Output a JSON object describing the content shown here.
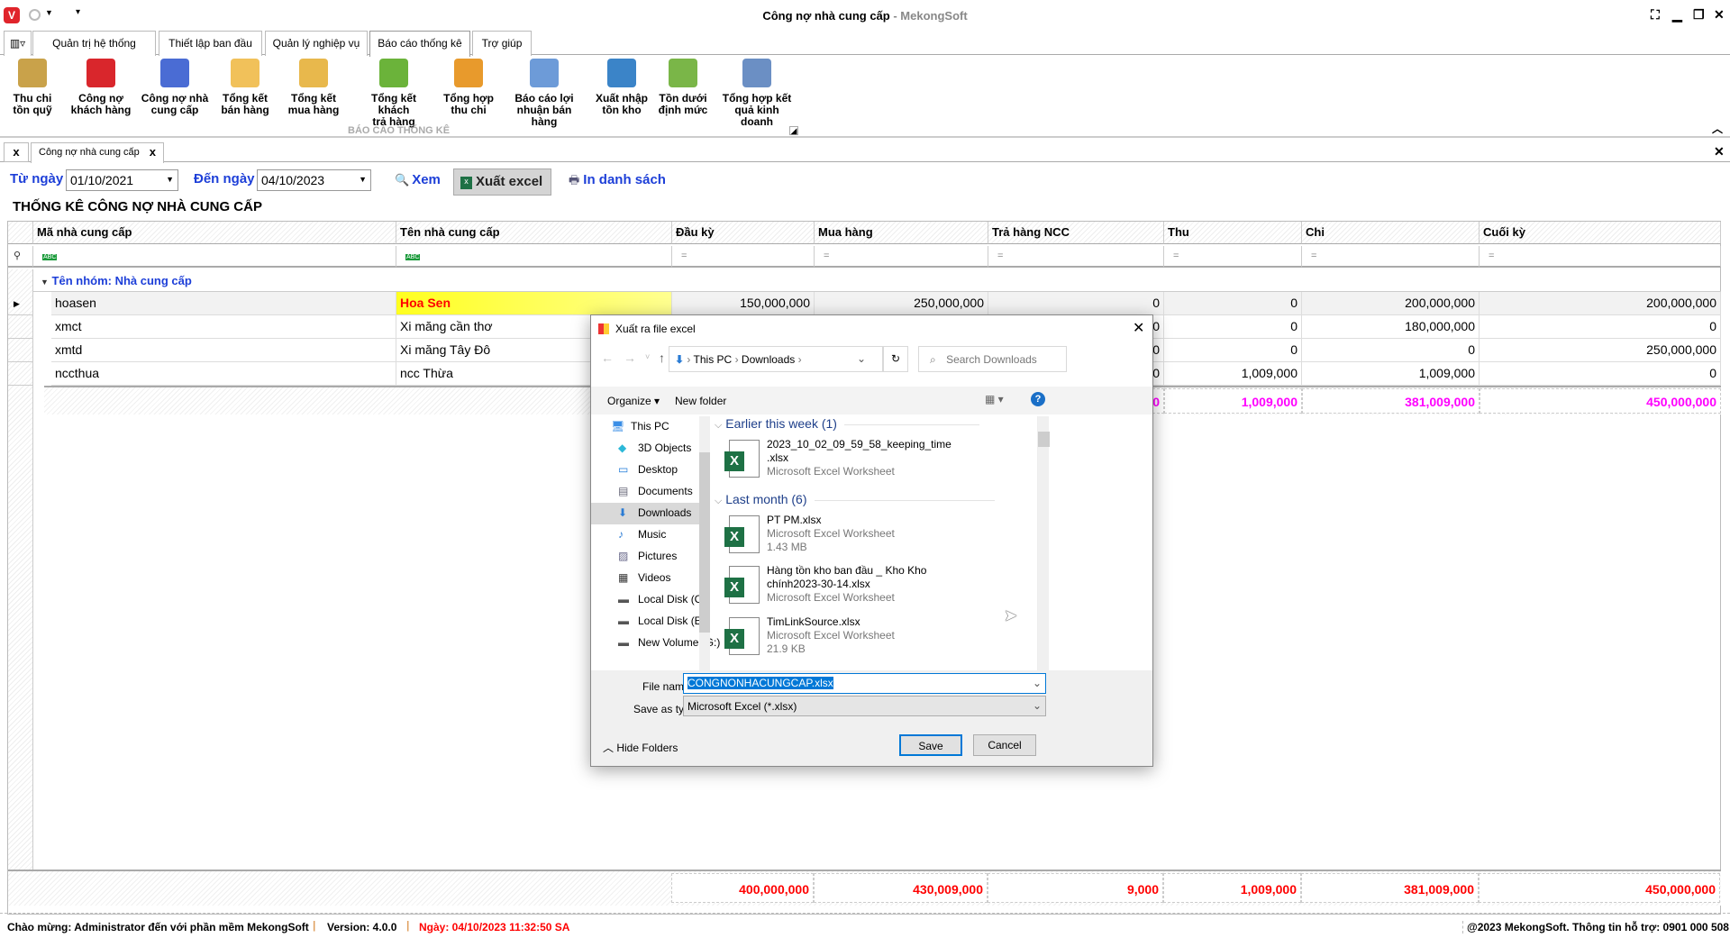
{
  "window": {
    "title": "Công nợ nhà cung cấp",
    "app": "MekongSoft",
    "app_sep": " - "
  },
  "ribbon": {
    "tabs": [
      "Quản trị hệ thống",
      "Thiết lập ban đầu",
      "Quản lý nghiệp vụ",
      "Báo cáo thống kê",
      "Trợ giúp"
    ],
    "active_tab": 3,
    "buttons": [
      [
        "Thu chi",
        "tồn quỹ"
      ],
      [
        "Công nợ",
        "khách hàng"
      ],
      [
        "Công nợ nhà",
        "cung cấp"
      ],
      [
        "Tổng kết",
        "bán hàng"
      ],
      [
        "Tổng kết",
        "mua hàng"
      ],
      [
        "Tổng kết khách",
        "trả hàng"
      ],
      [
        "Tổng hợp",
        "thu chi"
      ],
      [
        "Báo cáo lợi",
        "nhuận bán hàng"
      ],
      [
        "Xuất nhập",
        "tồn kho"
      ],
      [
        "Tồn dưới",
        "định mức"
      ],
      [
        "Tổng hợp kết",
        "quả kinh doanh"
      ]
    ],
    "group_label": "BÁO CÁO THỐNG KÊ"
  },
  "doc_tab": {
    "label": "Công nợ nhà cung cấp",
    "close": "x"
  },
  "toolbar": {
    "from_label": "Từ ngày",
    "from_value": "01/10/2021",
    "to_label": "Đến ngày",
    "to_value": "04/10/2023",
    "view": "Xem",
    "export": "Xuất excel",
    "print": "In danh sách"
  },
  "report_title": "THỐNG KÊ CÔNG NỢ NHÀ CUNG CẤP",
  "grid": {
    "columns": [
      "Mã nhà cung cấp",
      "Tên nhà cung cấp",
      "Đầu kỳ",
      "Mua hàng",
      "Trả hàng NCC",
      "Thu",
      "Chi",
      "Cuối kỳ"
    ],
    "filter_text": "ABC",
    "filter_eq": "=",
    "group_label": "Tên nhóm: Nhà cung cấp",
    "rows": [
      [
        "hoasen",
        "Hoa Sen",
        "150,000,000",
        "250,000,000",
        "0",
        "0",
        "200,000,000",
        "200,000,000"
      ],
      [
        "xmct",
        "Xi măng cần thơ",
        "",
        "",
        "0",
        "0",
        "180,000,000",
        "0"
      ],
      [
        "xmtd",
        "Xi măng Tây Đô",
        "",
        "",
        "0",
        "0",
        "0",
        "250,000,000"
      ],
      [
        "nccthua",
        "ncc Thừa",
        "",
        "",
        "0",
        "1,009,000",
        "1,009,000",
        "0"
      ]
    ],
    "group_totals": [
      "0",
      "1,009,000",
      "381,009,000",
      "450,000,000"
    ],
    "totals": [
      "400,000,000",
      "430,009,000",
      "9,000",
      "1,009,000",
      "381,009,000",
      "450,000,000"
    ]
  },
  "status": {
    "welcome": "Chào mừng: Administrator đến với phần mềm MekongSoft",
    "version": "Version: 4.0.0",
    "date": "Ngày: 04/10/2023 11:32:50 SA",
    "copyright": "@2023 MekongSoft. Thông tin hỗ trợ: 0901 000 508"
  },
  "dialog": {
    "title": "Xuất ra file excel",
    "path": [
      "This PC",
      "Downloads"
    ],
    "search_placeholder": "Search Downloads",
    "organize": "Organize",
    "new_folder": "New folder",
    "nav": [
      "This PC",
      "3D Objects",
      "Desktop",
      "Documents",
      "Downloads",
      "Music",
      "Pictures",
      "Videos",
      "Local Disk (C:)",
      "Local Disk (E:)",
      "New Volume (G:)"
    ],
    "groups": [
      {
        "label": "Earlier this week (1)",
        "files": [
          {
            "name": "2023_10_02_09_59_58_keeping_time .xlsx",
            "type": "Microsoft Excel Worksheet",
            "size": ""
          }
        ]
      },
      {
        "label": "Last month (6)",
        "files": [
          {
            "name": "PT PM.xlsx",
            "type": "Microsoft Excel Worksheet",
            "size": "1.43 MB"
          },
          {
            "name": "Hàng tồn kho ban đầu _ Kho Kho chính2023-30-14.xlsx",
            "type": "Microsoft Excel Worksheet",
            "size": ""
          },
          {
            "name": "TimLinkSource.xlsx",
            "type": "Microsoft Excel Worksheet",
            "size": "21.9 KB"
          }
        ]
      }
    ],
    "file_name_label": "File name:",
    "file_name": "CONGNONHACUNGCAP.xlsx",
    "save_type_label": "Save as type:",
    "save_type": "Microsoft Excel  (*.xlsx)",
    "save": "Save",
    "cancel": "Cancel",
    "hide_folders": "Hide Folders"
  },
  "colors": {
    "blue": "#1d3fd8",
    "red": "#ff0000",
    "magenta": "#ff00ff",
    "highlight": "#ffff40"
  }
}
